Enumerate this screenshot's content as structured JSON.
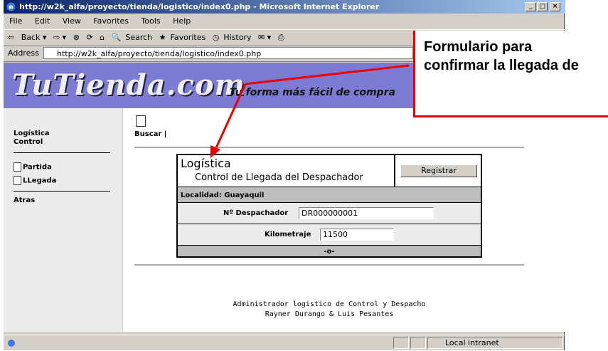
{
  "window": {
    "title": "http://w2k_alfa/proyecto/tienda/logistico/index0.php - Microsoft Internet Explorer"
  },
  "menu": [
    "File",
    "Edit",
    "View",
    "Favorites",
    "Tools",
    "Help"
  ],
  "toolbar": {
    "back": "Back",
    "search": "Search",
    "favorites": "Favorites",
    "history": "History"
  },
  "address": {
    "label": "Address",
    "url": "http://w2k_alfa/proyecto/tienda/logistico/index0.php"
  },
  "banner": {
    "logo": "TuTienda.com",
    "slogan": "Tu forma más fácil de compra"
  },
  "sidebar": {
    "title1": "Logística",
    "title2": "Control",
    "items": [
      "Partida",
      "LLegada"
    ],
    "back": "Atras"
  },
  "search_label": "Buscar |",
  "panel": {
    "title": "Logística",
    "subtitle": "Control de Llegada del Despachador",
    "button": "Registrar",
    "locality": "Localidad: Guayaquil",
    "dispatcher_label": "Nº Despachador",
    "dispatcher_value": "DR000000001",
    "km_label": "Kilometraje",
    "km_value": "11500",
    "footer": "-o-"
  },
  "footer": {
    "line1": "Administrador logistico de Control y Despacho",
    "line2": "Rayner Durango & Luis Pesantes"
  },
  "status": {
    "zone": "Local intranet"
  },
  "callout": {
    "text": "Formulario para confirmar la llegada de"
  }
}
